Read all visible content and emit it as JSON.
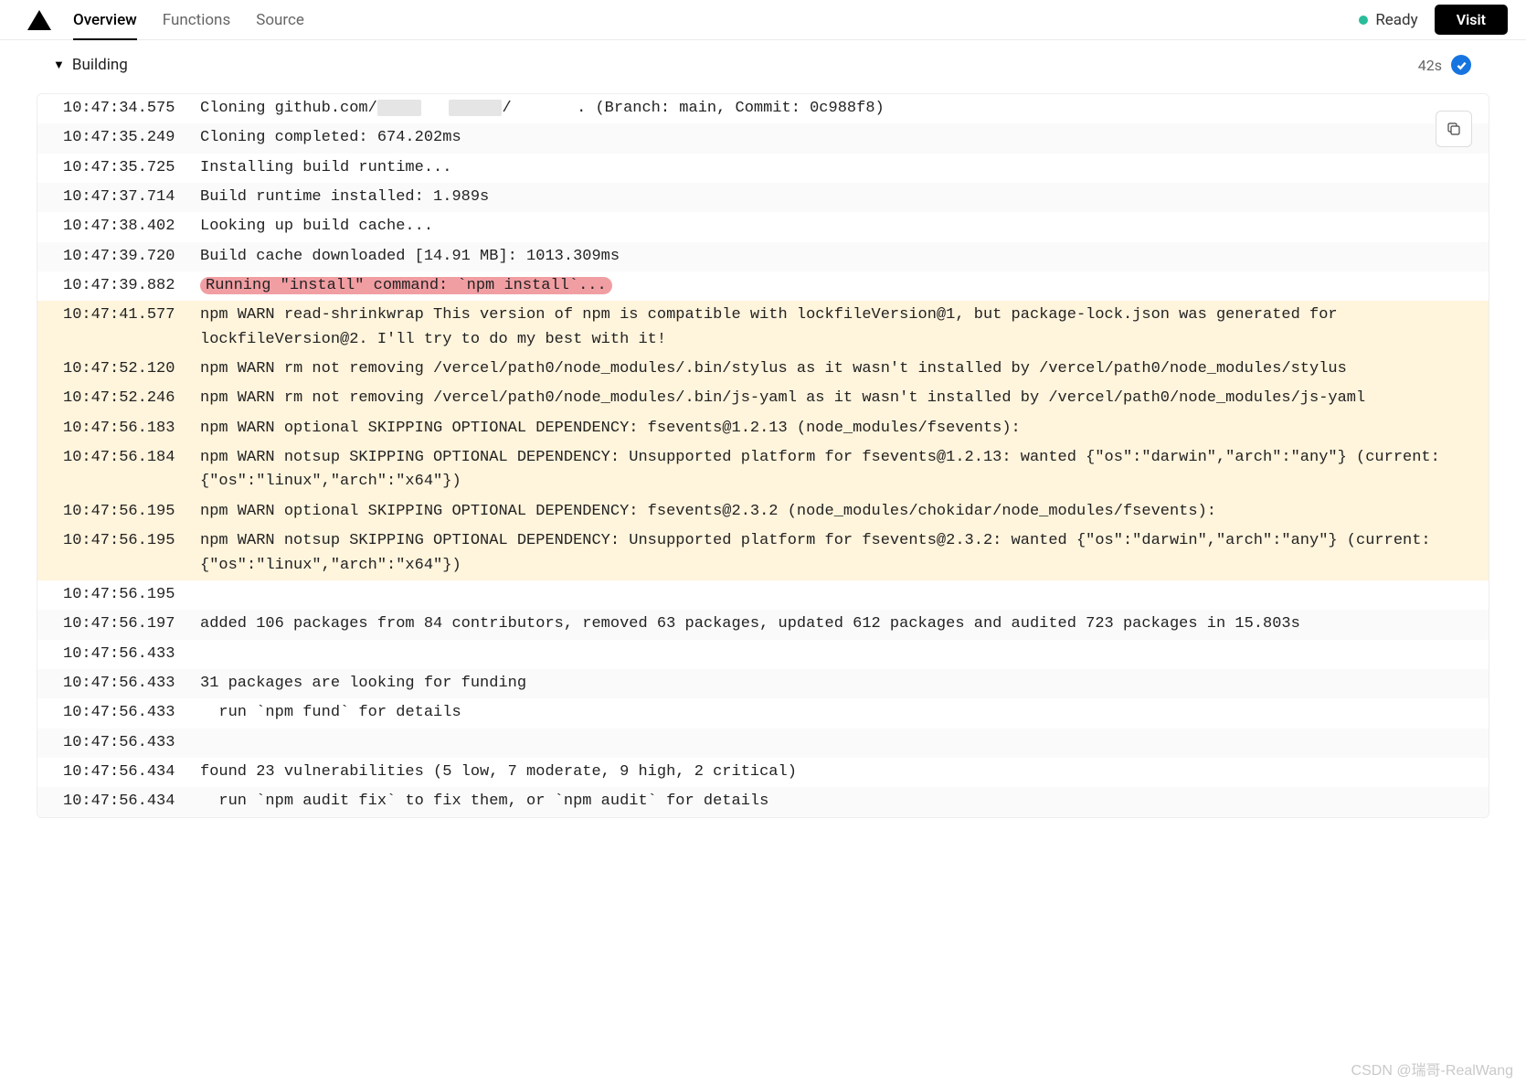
{
  "header": {
    "tabs": [
      "Overview",
      "Functions",
      "Source"
    ],
    "active_tab": 0,
    "status": "Ready",
    "visit_label": "Visit"
  },
  "section": {
    "title": "Building",
    "duration": "42s"
  },
  "logs": [
    {
      "ts": "10:47:34.575",
      "warn": false,
      "alt": false,
      "hl": false,
      "msg_pre": "Cloning github.com/",
      "redact1_w": 48,
      "msg_mid": "   ",
      "redact2_w": 58,
      "msg_post": "/       . (Branch: main, Commit: 0c988f8)"
    },
    {
      "ts": "10:47:35.249",
      "warn": false,
      "alt": true,
      "hl": false,
      "msg": "Cloning completed: 674.202ms"
    },
    {
      "ts": "10:47:35.725",
      "warn": false,
      "alt": false,
      "hl": false,
      "msg": "Installing build runtime..."
    },
    {
      "ts": "10:47:37.714",
      "warn": false,
      "alt": true,
      "hl": false,
      "msg": "Build runtime installed: 1.989s"
    },
    {
      "ts": "10:47:38.402",
      "warn": false,
      "alt": false,
      "hl": false,
      "msg": "Looking up build cache..."
    },
    {
      "ts": "10:47:39.720",
      "warn": false,
      "alt": true,
      "hl": false,
      "msg": "Build cache downloaded [14.91 MB]: 1013.309ms"
    },
    {
      "ts": "10:47:39.882",
      "warn": false,
      "alt": false,
      "hl": true,
      "msg": "Running \"install\" command: `npm install`..."
    },
    {
      "ts": "10:47:41.577",
      "warn": true,
      "alt": false,
      "hl": false,
      "msg": "npm WARN read-shrinkwrap This version of npm is compatible with lockfileVersion@1, but package-lock.json was generated for lockfileVersion@2. I'll try to do my best with it!"
    },
    {
      "ts": "10:47:52.120",
      "warn": true,
      "alt": false,
      "hl": false,
      "msg": "npm WARN rm not removing /vercel/path0/node_modules/.bin/stylus as it wasn't installed by /vercel/path0/node_modules/stylus"
    },
    {
      "ts": "10:47:52.246",
      "warn": true,
      "alt": false,
      "hl": false,
      "msg": "npm WARN rm not removing /vercel/path0/node_modules/.bin/js-yaml as it wasn't installed by /vercel/path0/node_modules/js-yaml"
    },
    {
      "ts": "10:47:56.183",
      "warn": true,
      "alt": false,
      "hl": false,
      "msg": "npm WARN optional SKIPPING OPTIONAL DEPENDENCY: fsevents@1.2.13 (node_modules/fsevents):"
    },
    {
      "ts": "10:47:56.184",
      "warn": true,
      "alt": false,
      "hl": false,
      "msg": "npm WARN notsup SKIPPING OPTIONAL DEPENDENCY: Unsupported platform for fsevents@1.2.13: wanted {\"os\":\"darwin\",\"arch\":\"any\"} (current: {\"os\":\"linux\",\"arch\":\"x64\"})"
    },
    {
      "ts": "10:47:56.195",
      "warn": true,
      "alt": false,
      "hl": false,
      "msg": "npm WARN optional SKIPPING OPTIONAL DEPENDENCY: fsevents@2.3.2 (node_modules/chokidar/node_modules/fsevents):"
    },
    {
      "ts": "10:47:56.195",
      "warn": true,
      "alt": false,
      "hl": false,
      "msg": "npm WARN notsup SKIPPING OPTIONAL DEPENDENCY: Unsupported platform for fsevents@2.3.2: wanted {\"os\":\"darwin\",\"arch\":\"any\"} (current: {\"os\":\"linux\",\"arch\":\"x64\"})"
    },
    {
      "ts": "10:47:56.195",
      "warn": false,
      "alt": false,
      "hl": false,
      "msg": ""
    },
    {
      "ts": "10:47:56.197",
      "warn": false,
      "alt": true,
      "hl": false,
      "msg": "added 106 packages from 84 contributors, removed 63 packages, updated 612 packages and audited 723 packages in 15.803s"
    },
    {
      "ts": "10:47:56.433",
      "warn": false,
      "alt": false,
      "hl": false,
      "msg": ""
    },
    {
      "ts": "10:47:56.433",
      "warn": false,
      "alt": true,
      "hl": false,
      "msg": "31 packages are looking for funding"
    },
    {
      "ts": "10:47:56.433",
      "warn": false,
      "alt": false,
      "hl": false,
      "msg": "  run `npm fund` for details"
    },
    {
      "ts": "10:47:56.433",
      "warn": false,
      "alt": true,
      "hl": false,
      "msg": ""
    },
    {
      "ts": "10:47:56.434",
      "warn": false,
      "alt": false,
      "hl": false,
      "msg": "found 23 vulnerabilities (5 low, 7 moderate, 9 high, 2 critical)"
    },
    {
      "ts": "10:47:56.434",
      "warn": false,
      "alt": true,
      "hl": false,
      "msg": "  run `npm audit fix` to fix them, or `npm audit` for details"
    }
  ],
  "watermark": "CSDN @瑞哥-RealWang"
}
